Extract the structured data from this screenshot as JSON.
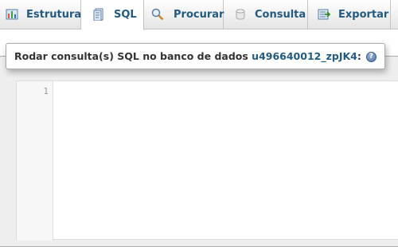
{
  "tabs": [
    {
      "label": "Estrutura",
      "icon": "structure-icon",
      "active": false
    },
    {
      "label": "SQL",
      "icon": "sql-icon",
      "active": true
    },
    {
      "label": "Procurar",
      "icon": "search-icon",
      "active": false
    },
    {
      "label": "Consulta",
      "icon": "query-icon",
      "active": false
    },
    {
      "label": "Exportar",
      "icon": "export-icon",
      "active": false
    }
  ],
  "query_box": {
    "legend_text": "Rodar consulta(s) SQL no banco de dados ",
    "database_name": "u496640012_zpJK4",
    "legend_suffix": ":",
    "help_icon": "help-icon"
  },
  "editor": {
    "line_numbers": [
      "1"
    ],
    "content": ""
  },
  "colors": {
    "link": "#235a81",
    "fieldset_bg": "#eeeeee",
    "tab_border": "#c4c4c4"
  }
}
